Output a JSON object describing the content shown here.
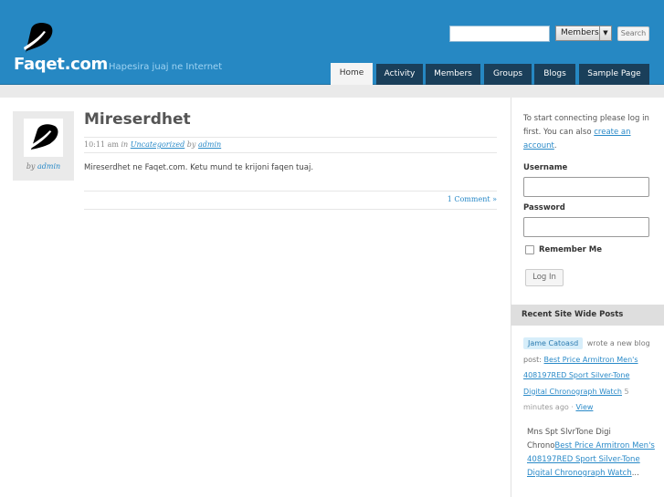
{
  "header": {
    "site_name": "Faqet.com",
    "tagline": "Hapesira juaj ne Internet",
    "search": {
      "value": "",
      "select_value": "Members",
      "button_label": "Search"
    },
    "nav": [
      {
        "label": "Home",
        "active": true
      },
      {
        "label": "Activity",
        "active": false
      },
      {
        "label": "Members",
        "active": false
      },
      {
        "label": "Groups",
        "active": false
      },
      {
        "label": "Blogs",
        "active": false
      },
      {
        "label": "Sample Page",
        "active": false
      }
    ]
  },
  "post": {
    "author_by": "by",
    "author_name": "admin",
    "title": "Mireserdhet",
    "time": "10:11 am",
    "in_word": "in",
    "category": "Uncategorized",
    "by_word": "by",
    "author": "admin",
    "body": "Mireserdhet ne Faqet.com. Ketu mund te krijoni faqen tuaj.",
    "comments": "1 Comment »"
  },
  "sidebar": {
    "intro_text": "To start connecting please log in first. You can also",
    "create_account_link": "create an account",
    "intro_end": ".",
    "username_label": "Username",
    "username_value": "",
    "password_label": "Password",
    "password_value": "",
    "remember_label": "Remember Me",
    "login_button": "Log In",
    "recent_header": "Recent Site Wide Posts",
    "activity": {
      "user": "Jame Catoasd",
      "action": "wrote a new blog post:",
      "post_link": "Best Price Armitron Men's 408197RED Sport Silver-Tone Digital Chronograph Watch",
      "time": "5 minutes ago",
      "separator": "·",
      "view": "View"
    },
    "excerpt": {
      "text": "Mns Spt SlvrTone Digi Chrono",
      "link": "Best Price Armitron Men's 408197RED Sport Silver-Tone Digital Chronograph Watch",
      "ellipsis": "..."
    }
  }
}
